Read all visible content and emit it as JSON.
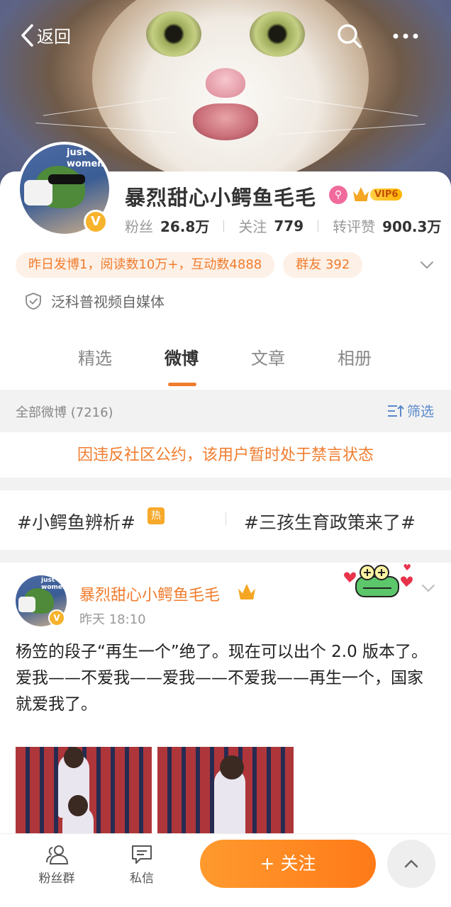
{
  "nav": {
    "back_label": "返回"
  },
  "profile": {
    "avatar_text": "just women",
    "username": "暴烈甜心小鳄鱼毛毛",
    "verify_mark": "V",
    "vip_label": "VIP6",
    "stats": [
      {
        "label": "粉丝",
        "value": "26.8万"
      },
      {
        "label": "关注",
        "value": "779"
      },
      {
        "label": "转评赞",
        "value": "900.3万"
      }
    ],
    "tags": [
      "昨日发博1，阅读数10万+，互动数4888",
      "群友 392"
    ],
    "category": "泛科普视频自媒体"
  },
  "tabs": [
    "精选",
    "微博",
    "文章",
    "相册"
  ],
  "active_tab": "微博",
  "filter": {
    "count_label": "全部微博 (7216)",
    "filter_label": "筛选"
  },
  "ban_notice": "因违反社区公约，该用户暂时处于禁言状态",
  "topics": [
    {
      "label": "#小鳄鱼辨析#",
      "badge": "热"
    },
    {
      "label": "#三孩生育政策来了#"
    }
  ],
  "post": {
    "author": "暴烈甜心小鳄鱼毛毛",
    "time": "昨天 18:10",
    "text_line1": "杨笠的段子“再生一个”绝了。现在可以出个 2.0 版本了。",
    "text_line2": "爱我——不爱我——爱我——不爱我——再生一个，国家就爱我了。"
  },
  "bottom": {
    "fans_group": "粉丝群",
    "message": "私信",
    "follow": "+ 关注"
  },
  "colors": {
    "accent": "#f07c2d",
    "link_blue": "#5a8acb",
    "verify": "#f7b32b"
  }
}
